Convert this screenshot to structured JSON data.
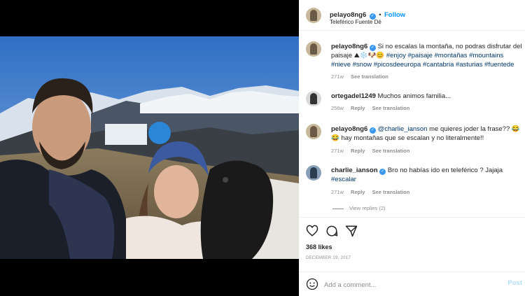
{
  "header": {
    "username": "pelayo8ng6",
    "follow_label": "Follow",
    "separator": "•",
    "location": "Teleférico Fuente Dé"
  },
  "caption": {
    "username": "pelayo8ng6",
    "text_plain": "Si no escalas la montaña, no podras disfrutar del paisaje ",
    "emojis": "⛰❄️🐶😊",
    "hashtags": "#enjoy #paisaje #montañas #mountains #nieve #snow #picosdeeuropa #cantabria #asturias #fuentede",
    "time": "271w",
    "see_translation": "See translation"
  },
  "comments": [
    {
      "username": "ortegadel1249",
      "text": "Muchos animos familia...",
      "time": "256w",
      "reply": "Reply",
      "see_translation": "See translation"
    },
    {
      "username": "pelayo8ng6",
      "mention": "@charlie_ianson",
      "text": " me quieres joder la frase?? 😂",
      "text2": "😂 hay montañas que se escalan y no literalmente!!",
      "time": "271w",
      "reply": "Reply",
      "see_translation": "See translation"
    },
    {
      "username": "charlie_ianson",
      "text": "Bro no habías ido en teleférico ? Jajaja",
      "hashtag": "#escalar",
      "time": "271w",
      "reply": "Reply",
      "see_translation": "See translation"
    }
  ],
  "view_replies": "View replies (2)",
  "actions": {
    "icons": [
      "heart-icon",
      "comment-icon",
      "share-icon"
    ]
  },
  "likes": "368 likes",
  "date": "DECEMBER 19, 2017",
  "add_comment": {
    "placeholder": "Add a comment...",
    "post_label": "Post"
  },
  "colors": {
    "link": "#0095f6",
    "hashtag": "#00376b",
    "muted": "#8e8e8e",
    "verified": "#3897f0"
  }
}
